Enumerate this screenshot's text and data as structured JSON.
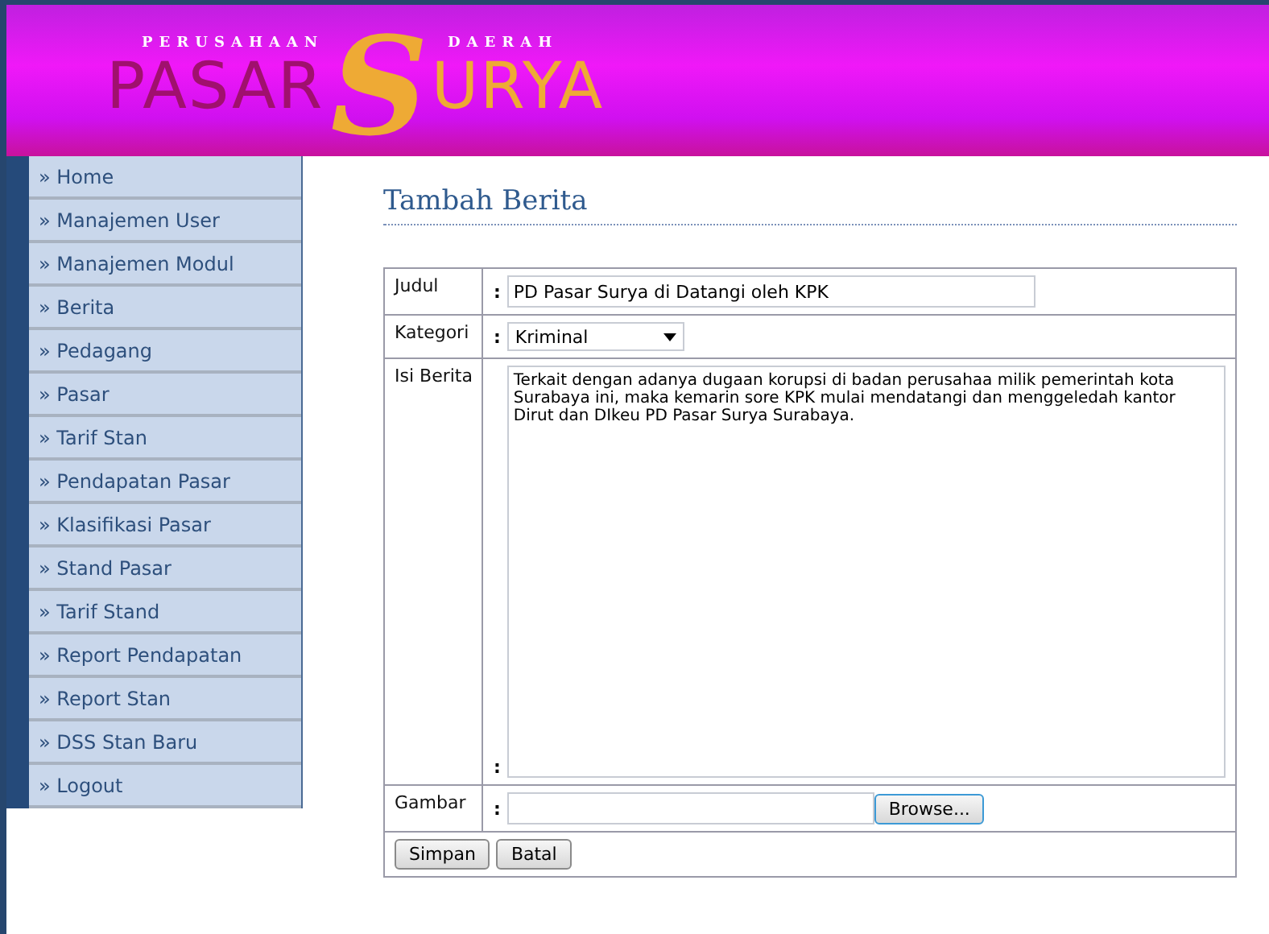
{
  "header": {
    "logo": {
      "top_left": "PERUSAHAAN",
      "top_right": "DAERAH",
      "left": "PASAR",
      "initial": "S",
      "right": "URYA"
    }
  },
  "sidebar": {
    "items": [
      {
        "label": "» Home"
      },
      {
        "label": "» Manajemen User"
      },
      {
        "label": "» Manajemen Modul"
      },
      {
        "label": "» Berita"
      },
      {
        "label": "» Pedagang"
      },
      {
        "label": "» Pasar"
      },
      {
        "label": "» Tarif Stan"
      },
      {
        "label": "» Pendapatan Pasar"
      },
      {
        "label": "» Klasifikasi Pasar"
      },
      {
        "label": "» Stand Pasar"
      },
      {
        "label": "» Tarif Stand"
      },
      {
        "label": "» Report Pendapatan"
      },
      {
        "label": "» Report Stan"
      },
      {
        "label": "» DSS Stan Baru"
      },
      {
        "label": "» Logout"
      }
    ]
  },
  "page_title": "Tambah Berita",
  "form": {
    "fields": [
      {
        "kind": "text",
        "label": "Judul",
        "colon": ":",
        "value": "PD Pasar Surya di Datangi oleh KPK"
      },
      {
        "kind": "select",
        "label": "Kategori",
        "colon": ":",
        "value": "Kriminal"
      },
      {
        "kind": "textarea",
        "label": "Isi Berita",
        "colon": ":",
        "value": "Terkait dengan adanya dugaan korupsi di badan perusahaa milik pemerintah kota Surabaya ini, maka kemarin sore KPK mulai mendatangi dan menggeledah kantor Dirut dan DIkeu PD Pasar Surya Surabaya."
      },
      {
        "kind": "file",
        "label": "Gambar",
        "colon": ":",
        "button": "Browse..."
      }
    ],
    "buttons": [
      "Simpan",
      "Batal"
    ]
  }
}
